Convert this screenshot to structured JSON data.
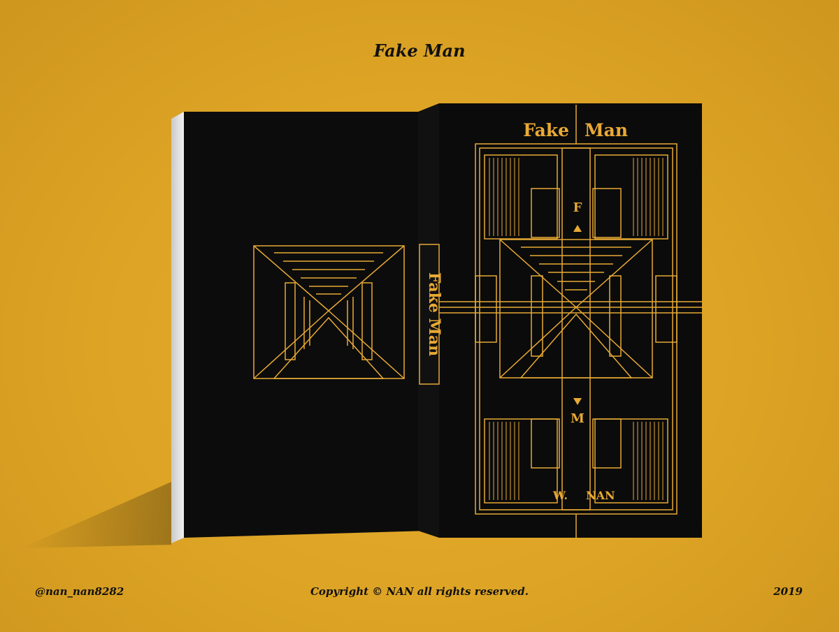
{
  "header": {
    "title": "Fake Man"
  },
  "cover": {
    "title_left": "Fake",
    "title_right": "Man",
    "letter_top": "F",
    "letter_bottom": "M",
    "author_prefix": "W.",
    "author_name": "NAN"
  },
  "spine": {
    "title": "Fake Man"
  },
  "footer": {
    "handle": "@nan_nan8282",
    "copyright": "Copyright © NAN all rights reserved.",
    "year": "2019"
  },
  "colors": {
    "background": "#dca325",
    "book": "#0d0d0d",
    "gold": "#e8a935"
  }
}
